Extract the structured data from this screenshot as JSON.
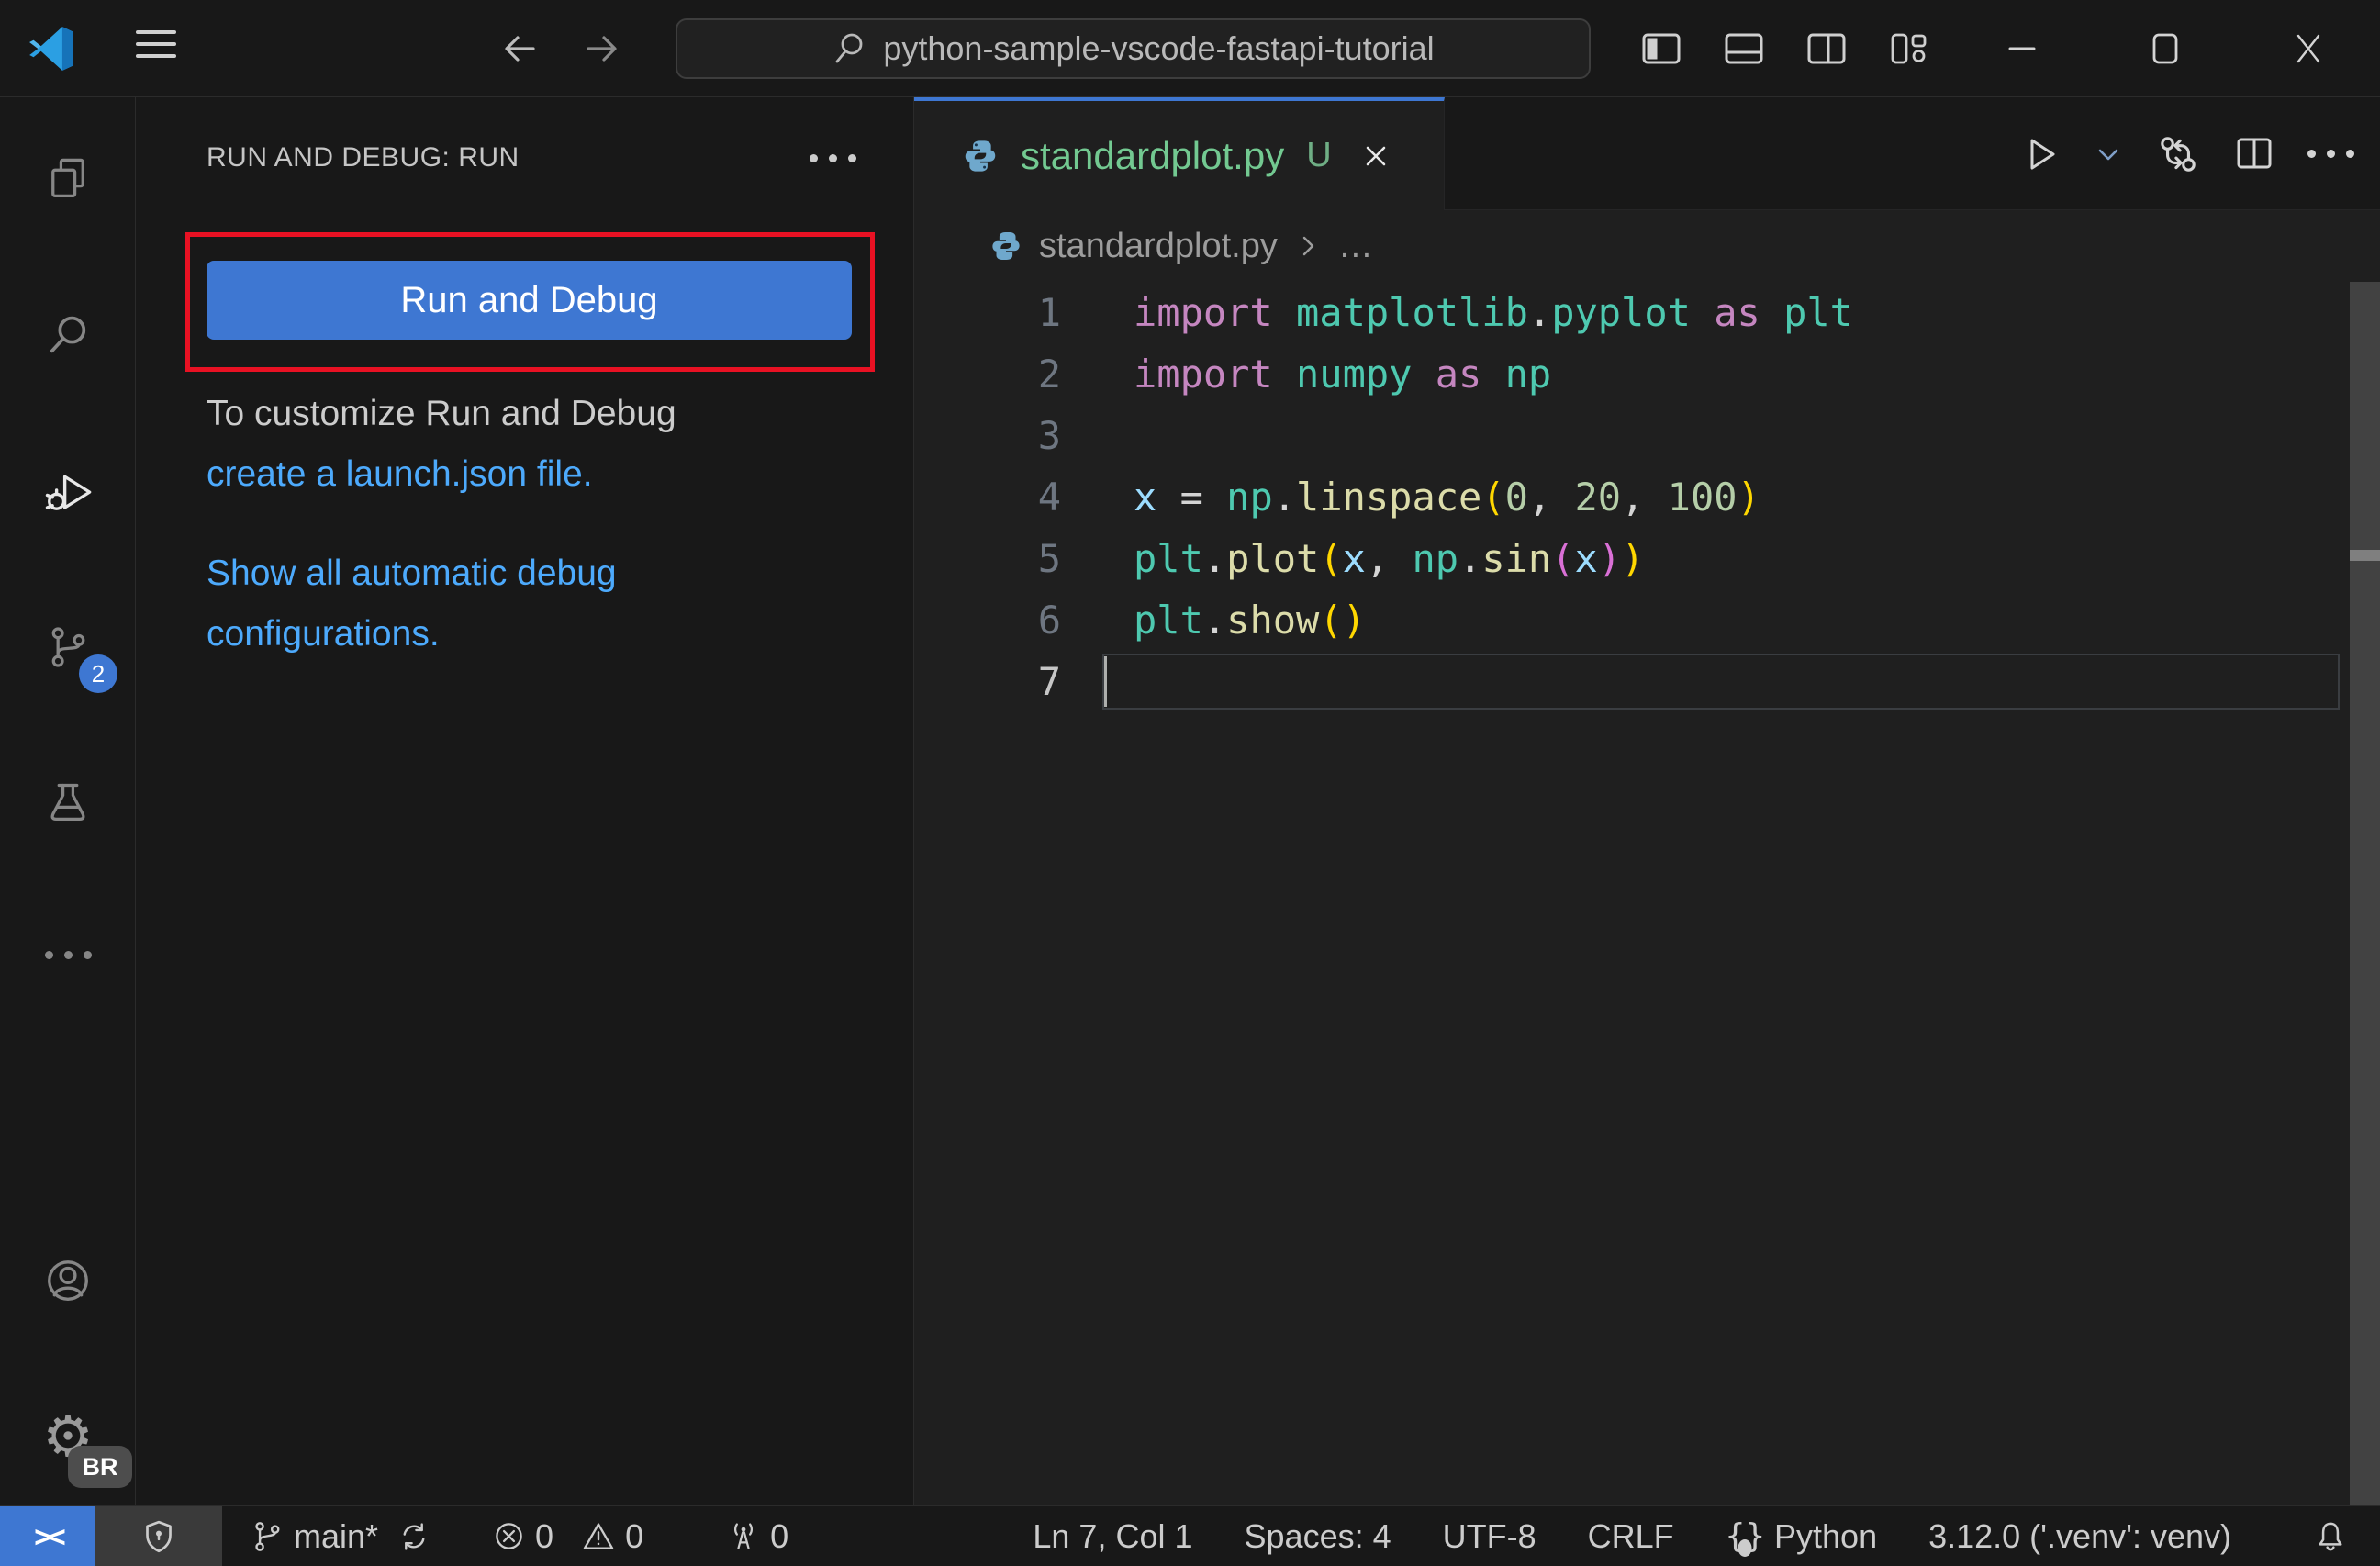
{
  "colors": {
    "bg": "#181818",
    "editor_bg": "#1f1f1f",
    "border": "#2b2b2b",
    "fg": "#cccccc",
    "accent": "#3e77d2",
    "link": "#4daafc",
    "red": "#e81123",
    "green": "#73c991",
    "linenum": "#6e7681",
    "shield": "#3a3a3a",
    "scroll": "#424242",
    "kw": "#C586C0",
    "mod": "#4EC9B0",
    "fn": "#DCDCAA",
    "var": "#9CDCFE",
    "num": "#B5CEA8",
    "pun": "#D4D4D4",
    "b1": "#FFD700",
    "b2": "#DA70D6"
  },
  "titlebar": {
    "search_value": "python-sample-vscode-fastapi-tutorial"
  },
  "activity_bar": {
    "scm_badge": "2",
    "profile_badge": "BR",
    "gear_glyph": "⚙"
  },
  "sidebar": {
    "header": "RUN AND DEBUG: RUN",
    "run_button_label": "Run and Debug",
    "hint_text": "To customize Run and Debug",
    "hint_link": "create a launch.json file.",
    "link2_line1": "Show all automatic debug",
    "link2_line2": "configurations."
  },
  "editor": {
    "tab_label": "standardplot.py",
    "tab_dirty": "U",
    "breadcrumb_file": "standardplot.py",
    "breadcrumb_more": "…",
    "code_lines": [
      {
        "num": "1",
        "tokens": [
          [
            "import",
            "kw"
          ],
          [
            " ",
            "pun"
          ],
          [
            "matplotlib",
            "mod"
          ],
          [
            ".",
            "pun"
          ],
          [
            "pyplot",
            "mod"
          ],
          [
            " ",
            "pun"
          ],
          [
            "as",
            "kw"
          ],
          [
            " ",
            "pun"
          ],
          [
            "plt",
            "mod"
          ]
        ]
      },
      {
        "num": "2",
        "tokens": [
          [
            "import",
            "kw"
          ],
          [
            " ",
            "pun"
          ],
          [
            "numpy",
            "mod"
          ],
          [
            " ",
            "pun"
          ],
          [
            "as",
            "kw"
          ],
          [
            " ",
            "pun"
          ],
          [
            "np",
            "mod"
          ]
        ]
      },
      {
        "num": "3",
        "tokens": []
      },
      {
        "num": "4",
        "tokens": [
          [
            "x",
            "var"
          ],
          [
            " = ",
            "pun"
          ],
          [
            "np",
            "mod"
          ],
          [
            ".",
            "pun"
          ],
          [
            "linspace",
            "fn"
          ],
          [
            "(",
            "b1"
          ],
          [
            "0",
            "num"
          ],
          [
            ", ",
            "pun"
          ],
          [
            "20",
            "num"
          ],
          [
            ", ",
            "pun"
          ],
          [
            "100",
            "num"
          ],
          [
            ")",
            "b1"
          ]
        ]
      },
      {
        "num": "5",
        "tokens": [
          [
            "plt",
            "mod"
          ],
          [
            ".",
            "pun"
          ],
          [
            "plot",
            "fn"
          ],
          [
            "(",
            "b1"
          ],
          [
            "x",
            "var"
          ],
          [
            ", ",
            "pun"
          ],
          [
            "np",
            "mod"
          ],
          [
            ".",
            "pun"
          ],
          [
            "sin",
            "fn"
          ],
          [
            "(",
            "b2"
          ],
          [
            "x",
            "var"
          ],
          [
            ")",
            "b2"
          ],
          [
            ")",
            "b1"
          ]
        ]
      },
      {
        "num": "6",
        "tokens": [
          [
            "plt",
            "mod"
          ],
          [
            ".",
            "pun"
          ],
          [
            "show",
            "fn"
          ],
          [
            "(",
            "b1"
          ],
          [
            ")",
            "b1"
          ]
        ]
      },
      {
        "num": "7",
        "tokens": [],
        "current": true
      }
    ]
  },
  "status_bar": {
    "branch": "main*",
    "errors": "0",
    "warnings": "0",
    "ports": "0",
    "line_col": "Ln 7, Col 1",
    "indent": "Spaces: 4",
    "encoding": "UTF-8",
    "eol": "CRLF",
    "language": "Python",
    "interpreter": "3.12.0 ('.venv': venv)"
  }
}
